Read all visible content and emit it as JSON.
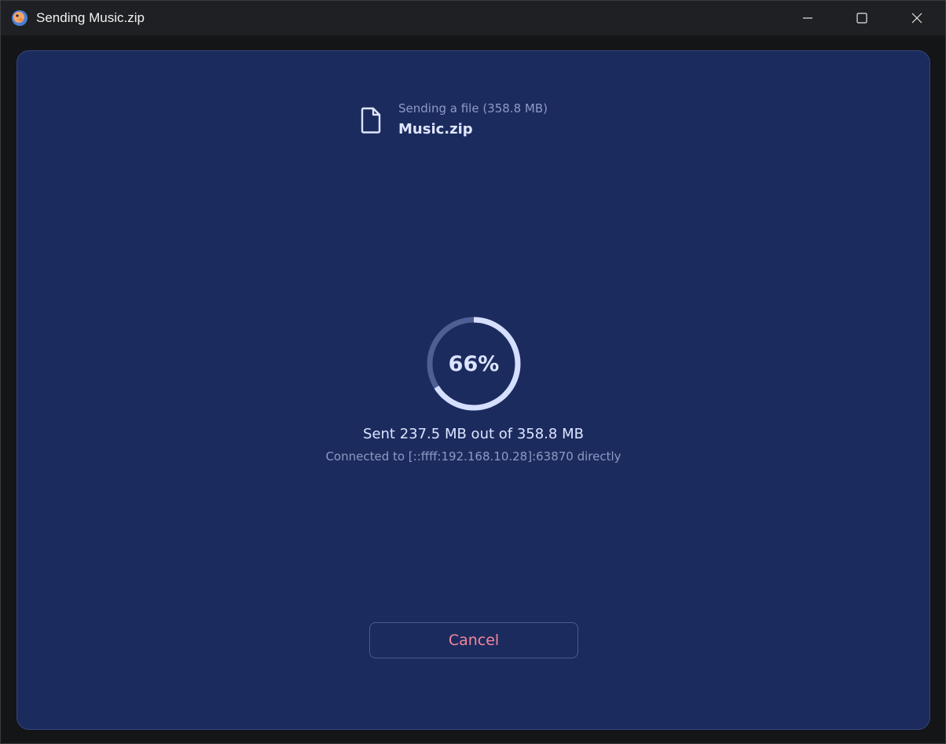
{
  "window": {
    "title": "Sending Music.zip",
    "icon": "app-icon"
  },
  "titlebar_controls": {
    "minimize": "minimize-icon",
    "maximize": "maximize-icon",
    "close": "close-icon"
  },
  "file": {
    "subtitle": "Sending a file (358.8 MB)",
    "name": "Music.zip",
    "icon": "file-icon"
  },
  "progress": {
    "label": "66%",
    "fraction": 0.66
  },
  "status": {
    "sent": "Sent 237.5 MB out of 358.8 MB",
    "connection": "Connected to [::ffff:192.168.10.28]:63870 directly"
  },
  "actions": {
    "cancel_label": "Cancel"
  },
  "colors": {
    "panel_bg": "#1c2b5e",
    "ring_track": "#4f5f94",
    "ring_fill": "#d5dfff",
    "cancel_text": "#f5869c"
  }
}
